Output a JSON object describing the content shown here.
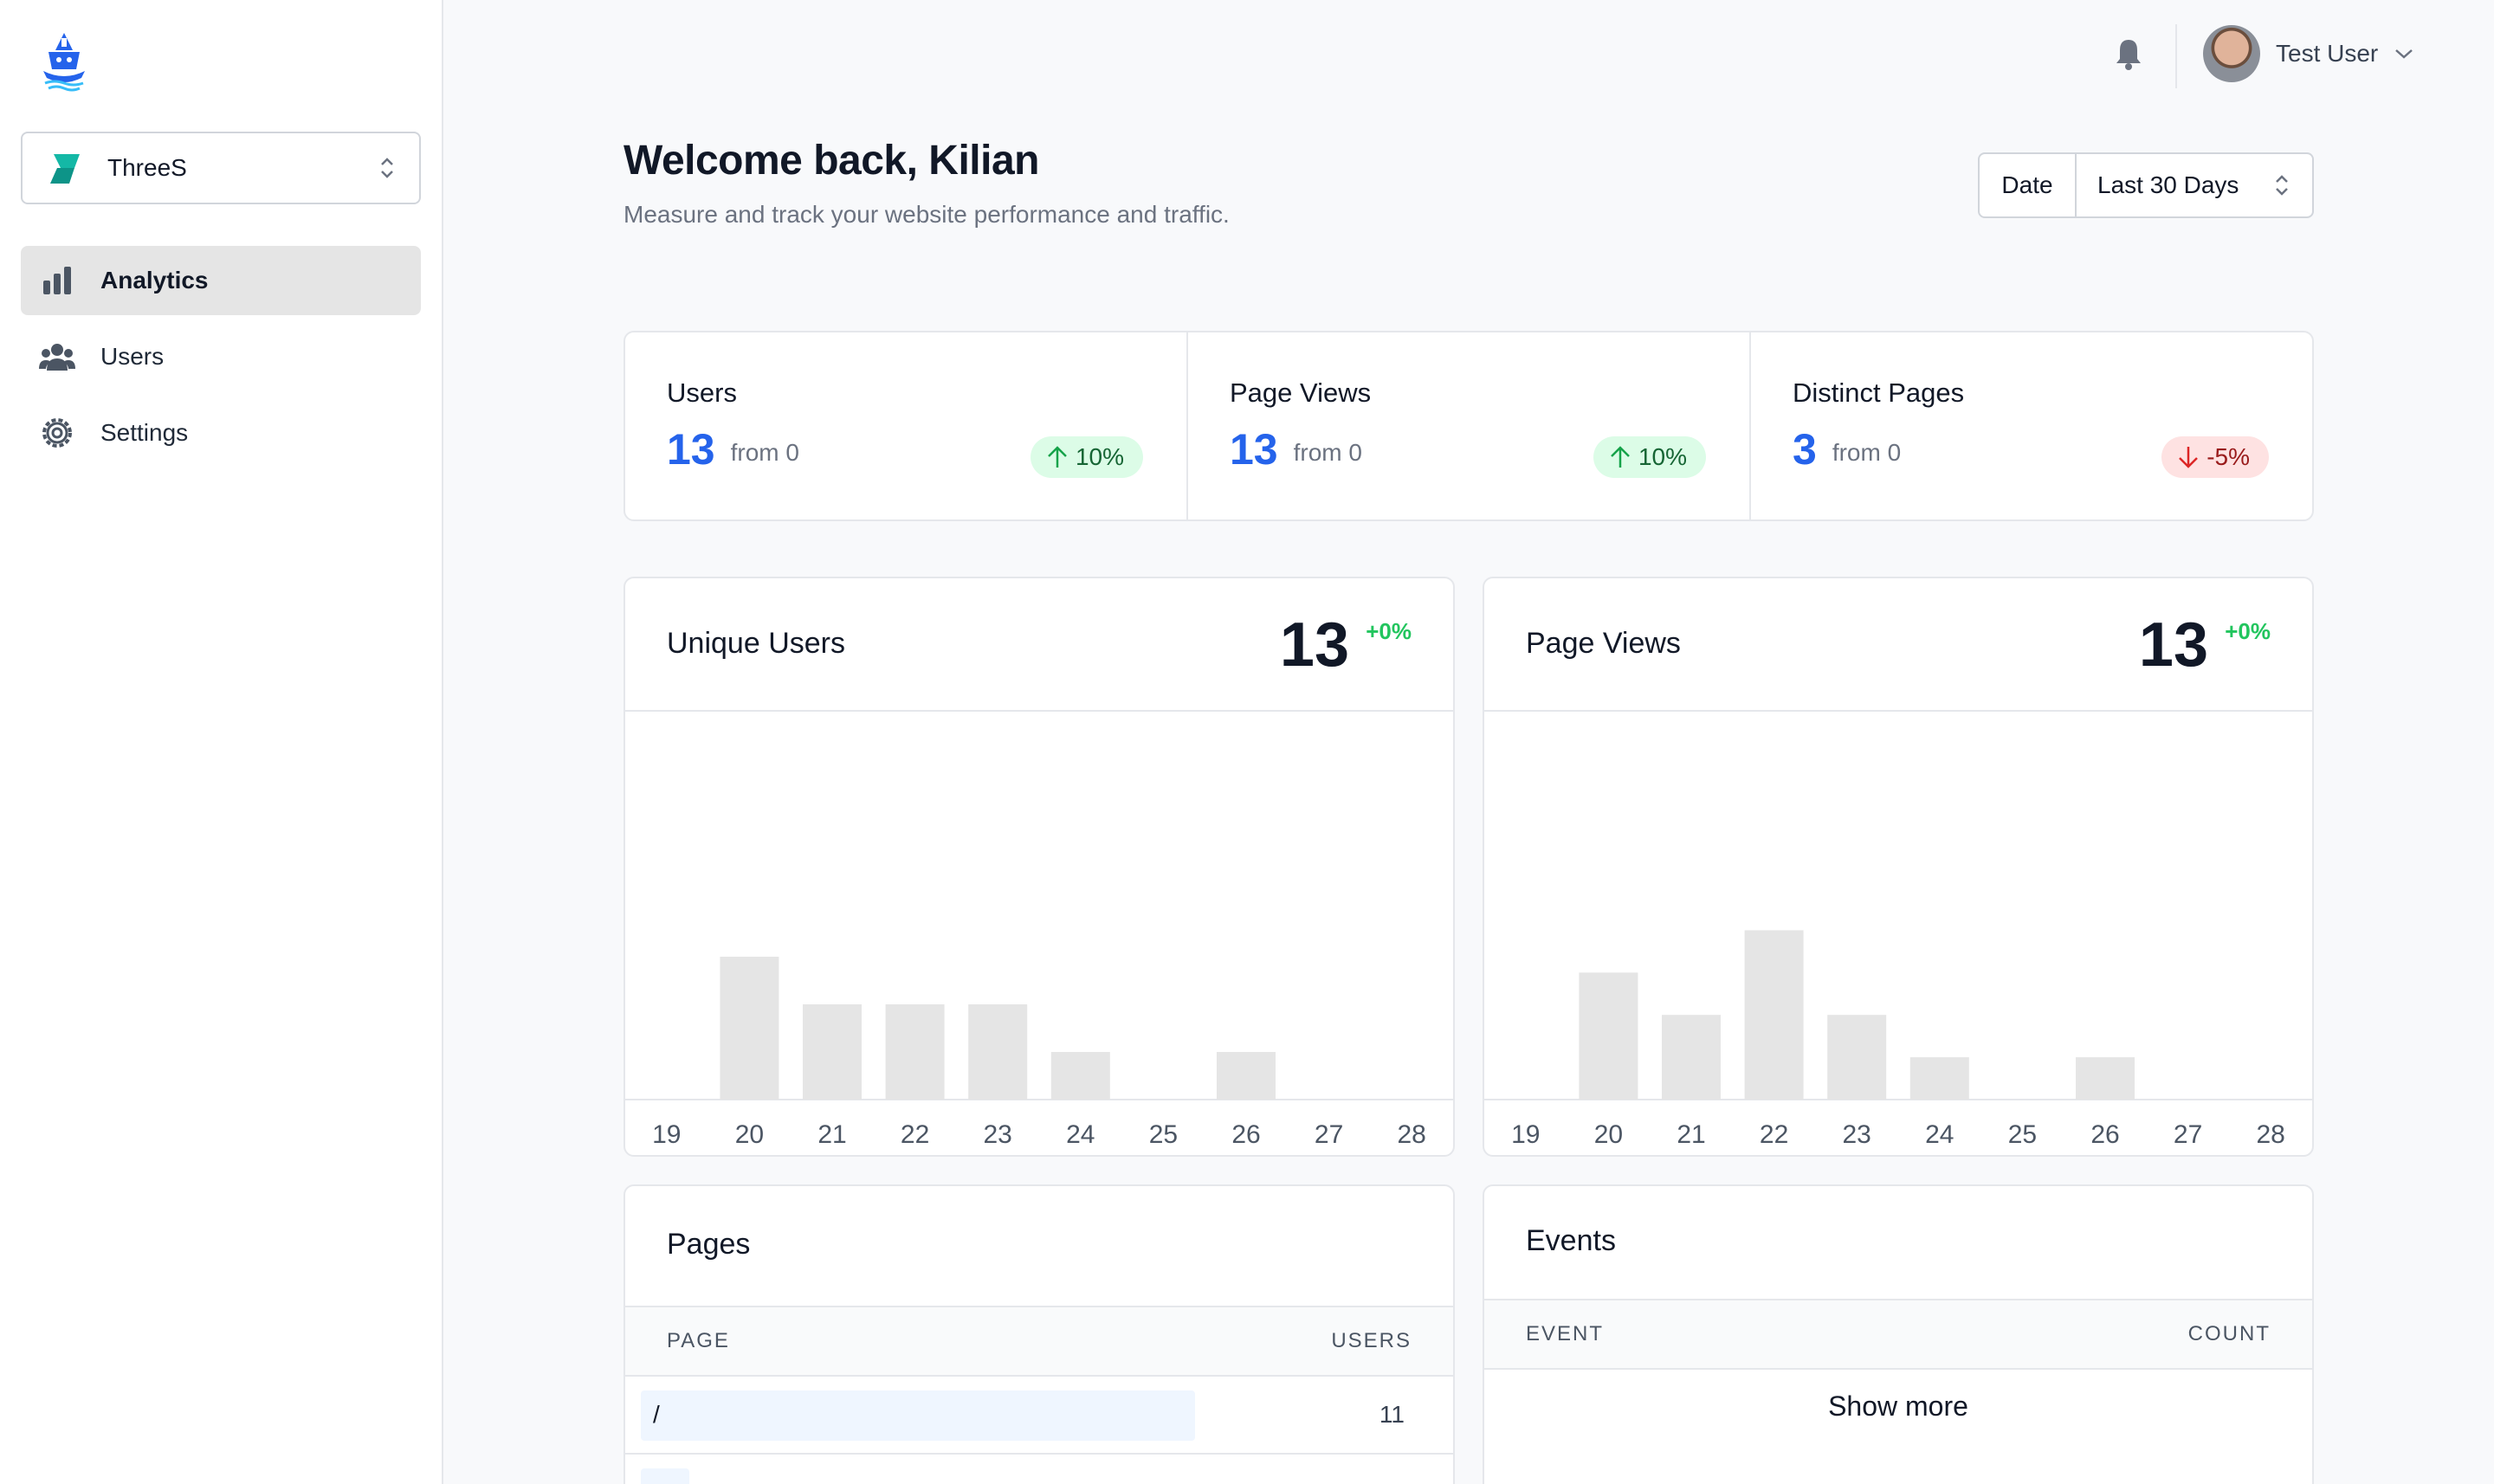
{
  "sidebar": {
    "project": "ThreeS",
    "items": [
      {
        "label": "Analytics",
        "icon": "bar-chart-icon",
        "active": true
      },
      {
        "label": "Users",
        "icon": "users-icon",
        "active": false
      },
      {
        "label": "Settings",
        "icon": "gear-icon",
        "active": false
      }
    ]
  },
  "topbar": {
    "user_name": "Test User"
  },
  "header": {
    "title": "Welcome back, Kilian",
    "subtitle": "Measure and track your website performance and traffic.",
    "date_label": "Date",
    "date_value": "Last 30 Days"
  },
  "stats": [
    {
      "title": "Users",
      "value": "13",
      "from": "from 0",
      "change": "10%",
      "trend": "up"
    },
    {
      "title": "Page Views",
      "value": "13",
      "from": "from 0",
      "change": "10%",
      "trend": "up"
    },
    {
      "title": "Distinct Pages",
      "value": "3",
      "from": "from 0",
      "change": "-5%",
      "trend": "down"
    }
  ],
  "charts": {
    "unique_users": {
      "title": "Unique Users",
      "total": "13",
      "delta": "+0%"
    },
    "page_views": {
      "title": "Page Views",
      "total": "13",
      "delta": "+0%"
    }
  },
  "chart_data": [
    {
      "type": "bar",
      "categories": [
        "19",
        "20",
        "21",
        "22",
        "23",
        "24",
        "25",
        "26",
        "27",
        "28"
      ],
      "values": [
        0,
        3,
        2,
        2,
        2,
        1,
        0,
        1,
        0,
        0
      ],
      "ylim": [
        0,
        8
      ],
      "bar_color": "#e5e5e5"
    },
    {
      "type": "bar",
      "categories": [
        "19",
        "20",
        "21",
        "22",
        "23",
        "24",
        "25",
        "26",
        "27",
        "28"
      ],
      "values": [
        0,
        3,
        2,
        4,
        2,
        1,
        0,
        1,
        0,
        0
      ],
      "ylim": [
        0,
        9
      ],
      "bar_color": "#e5e5e5"
    }
  ],
  "pages_table": {
    "title": "Pages",
    "col_page": "PAGE",
    "col_users": "USERS",
    "rows": [
      {
        "page": "/",
        "users": "11",
        "share": 0.69
      }
    ]
  },
  "events_table": {
    "title": "Events",
    "col_event": "EVENT",
    "col_count": "COUNT",
    "show_more": "Show more"
  },
  "colors": {
    "accent_blue": "#2563eb",
    "positive": "#22c55e",
    "negative": "#991b1b"
  }
}
